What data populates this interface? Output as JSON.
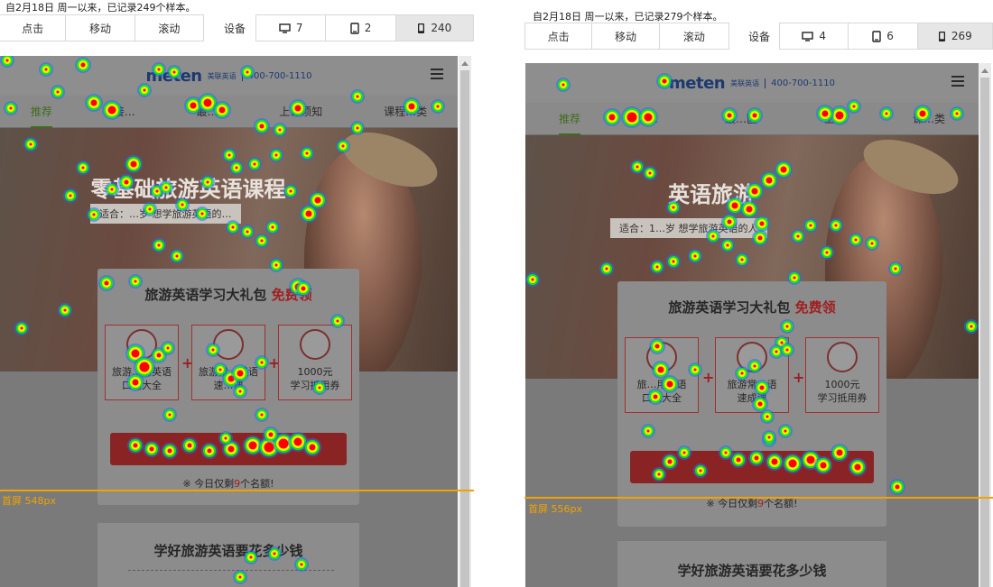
{
  "panels": [
    {
      "summary": "自2月18日 周一以来，已记录249个样本。",
      "tabs": [
        "点击",
        "移动",
        "滚动"
      ],
      "device_label": "设备",
      "devices": [
        {
          "icon": "desktop-icon",
          "count": "7"
        },
        {
          "icon": "tablet-icon",
          "count": "2"
        },
        {
          "icon": "phone-icon",
          "count": "240",
          "active": true
        }
      ],
      "page": {
        "logo": "meten",
        "logo_sub": "美联英语",
        "phone": "400-700-1110",
        "nav": [
          "推荐",
          "接…",
          "最…",
          "上课须知",
          "课程…类"
        ],
        "hero_title": "零基础旅游英语课程",
        "hero_sub": "适合：…岁 想学旅游英语的…",
        "card_title": "旅游英语学习大礼包",
        "card_free": "免费领",
        "gifts": [
          [
            "旅游…用英语",
            "口语大全"
          ],
          [
            "旅游常…英语",
            "速…课"
          ],
          [
            "1000元",
            "学习抵用券"
          ]
        ],
        "remain_prefix": "※ 今日仅剩",
        "remain_num": "9",
        "remain_suffix": "个名额!",
        "section2_title": "学好旅游英语要花多少钱"
      },
      "fold_label": "首屏 548px"
    },
    {
      "summary": "自2月18日 周一以来，已记录279个样本。",
      "tabs": [
        "点击",
        "移动",
        "滚动"
      ],
      "device_label": "设备",
      "devices": [
        {
          "icon": "desktop-icon",
          "count": "4"
        },
        {
          "icon": "tablet-icon",
          "count": "6"
        },
        {
          "icon": "phone-icon",
          "count": "269",
          "active": true
        }
      ],
      "page": {
        "logo": "meten",
        "logo_sub": "美联英语",
        "phone": "400-700-1110",
        "nav": [
          "推荐",
          "…",
          "最…区",
          "上…",
          "课…类"
        ],
        "hero_title": "英语旅游",
        "hero_sub": "适合：1…岁 想学旅游英语的人",
        "card_title": "旅游英语学习大礼包",
        "card_free": "免费领",
        "gifts": [
          [
            "旅…用英语",
            "口语大全"
          ],
          [
            "旅游常…语",
            "速成课"
          ],
          [
            "1000元",
            "学习抵用券"
          ]
        ],
        "remain_prefix": "※ 今日仅剩",
        "remain_num": "9",
        "remain_suffix": "个名额!",
        "section2_title": "学好旅游英语要花多少钱"
      },
      "fold_label": "首屏 556px"
    }
  ],
  "colors": {
    "fold_line": "#f2a200",
    "heat_hot": "#ff0000",
    "heat_mid": "#ffee00",
    "heat_cool": "#00ff00",
    "heat_edge": "#2a6bff"
  }
}
